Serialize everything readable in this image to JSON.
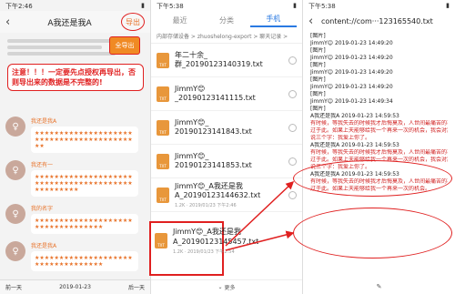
{
  "panel1": {
    "status_time": "下午2:46",
    "title": "A我还是我A",
    "export_label": "导出",
    "all_export_label": "全导出",
    "warning_text": "注意！！！一定要先点授权再导出，否则导出来的数据是不完整的!",
    "messages": [
      {
        "name": "我还是我A",
        "text": "★★★★★★★★★★★★★★★★★★★★★★★★★★★★★★★★★★★★★★★★★★"
      },
      {
        "name": "我还有一",
        "text": "★★★★★★★★★★★★★★★★★★★★★★★★★★★★★★★★★★★★★★★★★★★★★★★★★"
      },
      {
        "name": "我的名字",
        "text": "★★★★★★★★★★★★★★★★★★★★★★★★★★★★★★★★★★"
      },
      {
        "name": "我还是我A",
        "text": "★★★★★★★★★★★★★★★★★★★★★★★★★★★★★★★★★★"
      }
    ],
    "footer_left": "前一天",
    "footer_date": "2019-01-23",
    "footer_right": "后一天"
  },
  "panel2": {
    "status_time": "下午5:38",
    "tabs": [
      "最近",
      "分类",
      "手机"
    ],
    "breadcrumb": "内部存储设备 > zhuoshelong-export > 聊天记录 >",
    "files": [
      {
        "name": "年二十余_",
        "name2": "群_20190123140319.txt",
        "meta": "1.2K · 2019/01/23 下午2:03"
      },
      {
        "name": "JimmY😊",
        "name2": "_20190123141115.txt",
        "meta": "1.2K · 2019/01/23 下午2:11"
      },
      {
        "name": "JimmY😊_",
        "name2": "20190123141843.txt",
        "meta": "1.2K · 2019/01/23 下午2:18"
      },
      {
        "name": "JimmY😊_",
        "name2": "20190123141853.txt",
        "meta": "1.2K · 2019/01/23 下午2:18"
      },
      {
        "name": "JimmY😊_A我还是我",
        "name2": "A_20190123144632.txt",
        "meta": "1.2K · 2019/01/23 下午2:46"
      }
    ],
    "highlight": {
      "name": "JimmY😊_A我还是我",
      "name2": "A_20190123145457.txt",
      "meta": "1.2K · 2019/01/23 下午2:54"
    },
    "footer": "更多"
  },
  "panel3": {
    "status_time": "下午5:38",
    "title": "content://com···123165540.txt",
    "lines": [
      "[图片]",
      "JimmY😊 2019-01-23 14:49:20",
      "[图片]",
      "JimmY😊 2019-01-23 14:49:20",
      "[图片]",
      "JimmY😊 2019-01-23 14:49:20",
      "[图片]",
      "JimmY😊 2019-01-23 14:49:20",
      "[图片]",
      "JimmY😊 2019-01-23 14:49:34",
      "[图片]",
      "A我还是我A 2019-01-23 14:59:53",
      "有时候，等我失去的时候我才后悔莫及，人世间最痛苦的事莫",
      "过于此。如果上天能够给我一个再来一次的机会，我会对那个女孩子",
      "说三个字：我爱上你了。",
      "A我还是我A 2019-01-23 14:59:53",
      "有时候，等我失去的时候我才后悔莫及，人世间最痛苦的事莫",
      "过于此。如果上天能够给我一个再来一次的机会，我会对那个女孩子",
      "说三个字：我爱上你了。",
      "A我还是我A 2019-01-23 14:59:53",
      "有时候，等我失去的时候我才后悔莫及，人世间最痛苦的事莫",
      "过于此。如果上天能够给我一个再来一次的机会。"
    ]
  },
  "colors": {
    "accent": "#e8732a",
    "warning": "#e02020",
    "blue": "#2a7ae2"
  }
}
